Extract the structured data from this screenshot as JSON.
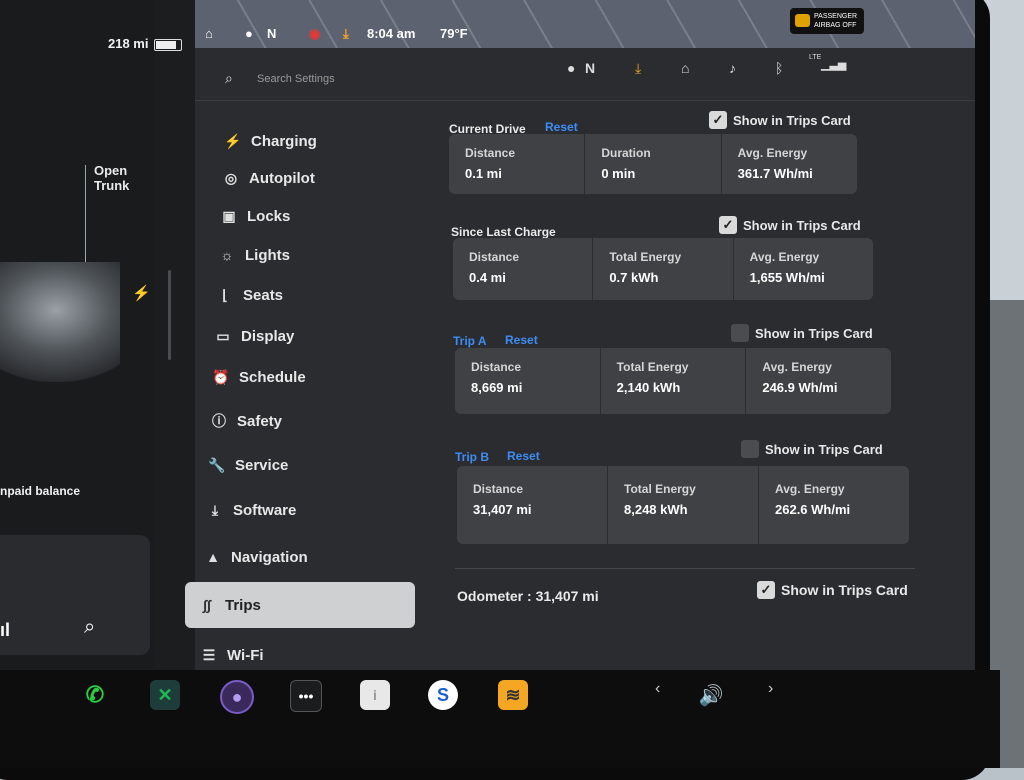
{
  "status_bar": {
    "range": "218 mi",
    "gear": "N",
    "time": "8:04 am",
    "temp": "79°F",
    "airbag_line1": "PASSENGER",
    "airbag_line2": "AIRBAG OFF"
  },
  "car_panel": {
    "open_label": "Open",
    "trunk_label": "Trunk",
    "unpaid": "npaid balance"
  },
  "search": {
    "placeholder": "Search Settings"
  },
  "header_icons": {
    "profile_label": "N",
    "network": "LTE"
  },
  "nav": [
    {
      "label": "Charging",
      "icon": "lightning-icon"
    },
    {
      "label": "Autopilot",
      "icon": "steering-wheel-icon"
    },
    {
      "label": "Locks",
      "icon": "lock-icon"
    },
    {
      "label": "Lights",
      "icon": "light-icon"
    },
    {
      "label": "Seats",
      "icon": "seat-icon"
    },
    {
      "label": "Display",
      "icon": "display-icon"
    },
    {
      "label": "Schedule",
      "icon": "clock-icon"
    },
    {
      "label": "Safety",
      "icon": "alert-icon"
    },
    {
      "label": "Service",
      "icon": "wrench-icon"
    },
    {
      "label": "Software",
      "icon": "download-icon"
    },
    {
      "label": "Navigation",
      "icon": "navigation-icon"
    },
    {
      "label": "Trips",
      "icon": "trips-icon",
      "active": true
    },
    {
      "label": "Wi-Fi",
      "icon": "wifi-icon"
    }
  ],
  "sections": {
    "current_drive": {
      "title": "Current Drive",
      "reset": "Reset",
      "show": "Show in Trips Card",
      "checked": true,
      "cells": [
        {
          "label": "Distance",
          "value": "0.1 mi"
        },
        {
          "label": "Duration",
          "value": "0 min"
        },
        {
          "label": "Avg. Energy",
          "value": "361.7 Wh/mi"
        }
      ]
    },
    "since_last_charge": {
      "title": "Since Last Charge",
      "show": "Show in Trips Card",
      "checked": true,
      "cells": [
        {
          "label": "Distance",
          "value": "0.4 mi"
        },
        {
          "label": "Total Energy",
          "value": "0.7 kWh"
        },
        {
          "label": "Avg. Energy",
          "value": "1,655 Wh/mi"
        }
      ]
    },
    "trip_a": {
      "title": "Trip A",
      "reset": "Reset",
      "show": "Show in Trips Card",
      "checked": false,
      "cells": [
        {
          "label": "Distance",
          "value": "8,669 mi"
        },
        {
          "label": "Total Energy",
          "value": "2,140 kWh"
        },
        {
          "label": "Avg. Energy",
          "value": "246.9 Wh/mi"
        }
      ]
    },
    "trip_b": {
      "title": "Trip B",
      "reset": "Reset",
      "show": "Show in Trips Card",
      "checked": false,
      "cells": [
        {
          "label": "Distance",
          "value": "31,407 mi"
        },
        {
          "label": "Total Energy",
          "value": "8,248 kWh"
        },
        {
          "label": "Avg. Energy",
          "value": "262.6 Wh/mi"
        }
      ]
    },
    "odometer": {
      "label": "Odometer : 31,407 mi",
      "show": "Show in Trips Card",
      "checked": true
    }
  },
  "dock": [
    {
      "icon": "phone-icon",
      "color": "#2ecc40"
    },
    {
      "icon": "shuffle-icon",
      "color": "#1db954"
    },
    {
      "icon": "camera-icon",
      "color": "#7a5cc7"
    },
    {
      "icon": "more-icon",
      "color": "#ffffff"
    },
    {
      "icon": "notes-icon",
      "color": "#e8e8e8"
    },
    {
      "icon": "sirius-icon",
      "color": "#1a5fd6"
    },
    {
      "icon": "audible-icon",
      "color": "#f5a623"
    },
    {
      "icon": "volume-icon",
      "color": "#ffffff"
    }
  ],
  "colors": {
    "accent": "#3d8df5",
    "panel": "#2b2c2f",
    "card": "#3f4144",
    "active_nav": "#cfd0d2"
  }
}
